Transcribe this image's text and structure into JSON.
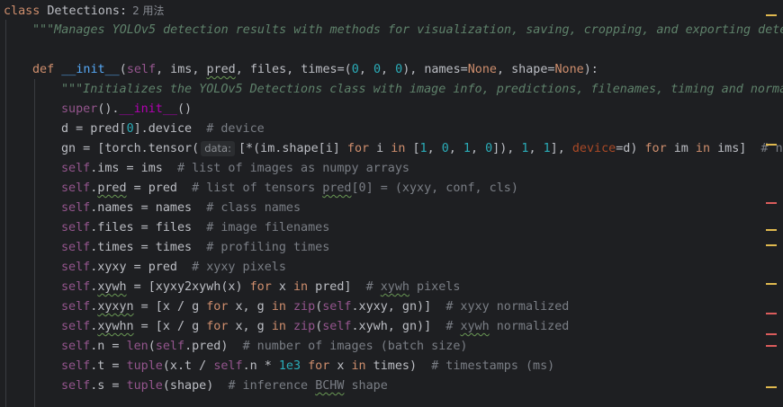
{
  "code": {
    "class_kw": "class",
    "class_name": "Detections",
    "class_colon": ":",
    "usages": "2 用法",
    "docstring_class": "\"\"\"Manages YOLOv5 detection results with methods for visualization, saving, cropping, and exporting dete",
    "def_kw": "def",
    "init_name": "__init__",
    "init_params_open": "(",
    "p_self": "self",
    "init_params_mid": ", ims, ",
    "p_pred": "pred",
    "init_params_mid2": ", files, times=(",
    "z1": "0",
    "c1": ", ",
    "z2": "0",
    "c2": ", ",
    "z3": "0",
    "init_params_mid3": "), names=",
    "none1": "None",
    "init_params_mid4": ", shape=",
    "none2": "None",
    "init_params_close": "):",
    "docstring_init": "\"\"\"Initializes the YOLOv5 Detections class with image info, predictions, filenames, timing and norma",
    "super_call": "super",
    "super_rest": "().",
    "super_init": "__init__",
    "super_end": "()",
    "d_line": "d = pred[",
    "d_zero": "0",
    "d_rest": "].device",
    "d_comment": "# device",
    "gn_start": "gn = [torch.tensor(",
    "gn_hint": "data:",
    "gn_mid": "[*(im.shape[i] ",
    "gn_for": "for",
    "gn_i": " i ",
    "gn_in": "in",
    "gn_list_open": " [",
    "gn_n1": "1",
    "gn_c1": ", ",
    "gn_n2": "0",
    "gn_c2": ", ",
    "gn_n3": "1",
    "gn_c3": ", ",
    "gn_n4": "0",
    "gn_close1": "]), ",
    "gn_n5": "1",
    "gn_c5": ", ",
    "gn_n6": "1",
    "gn_c6": "], ",
    "gn_device": "device",
    "gn_eq": "=d) ",
    "gn_for2": "for",
    "gn_im": " im ",
    "gn_in2": "in",
    "gn_ims": " ims]  ",
    "gn_comment": "# n",
    "l_ims_self": "self",
    "l_ims": ".ims = ims  ",
    "l_ims_c": "# list of images as numpy arrays",
    "l_pred_self": "self",
    "l_pred_dot": ".",
    "l_pred_name": "pred",
    "l_pred_eq": " = pred  ",
    "l_pred_c1": "# list of tensors ",
    "l_pred_c2": "pred",
    "l_pred_c3": "[0] = (xyxy, conf, cls)",
    "l_names_self": "self",
    "l_names": ".names = names  ",
    "l_names_c": "# class names",
    "l_files_self": "self",
    "l_files": ".files = files  ",
    "l_files_c": "# image filenames",
    "l_times_self": "self",
    "l_times": ".times = times  ",
    "l_times_c": "# profiling times",
    "l_xyxy_self": "self",
    "l_xyxy": ".xyxy = pred  ",
    "l_xyxy_c": "# xyxy pixels",
    "l_xywh_self": "self",
    "l_xywh_dot": ".",
    "l_xywh_name": "xywh",
    "l_xywh_eq": " = [xyxy2xywh(x) ",
    "l_xywh_for": "for",
    "l_xywh_x": " x ",
    "l_xywh_in": "in",
    "l_xywh_end": " pred]  ",
    "l_xywh_c1": "# ",
    "l_xywh_c2": "xywh",
    "l_xywh_c3": " pixels",
    "l_xyxyn_self": "self",
    "l_xyxyn_dot": ".",
    "l_xyxyn_name": "xyxyn",
    "l_xyxyn_eq": " = [x / g ",
    "l_xyxyn_for": "for",
    "l_xyxyn_xg": " x, g ",
    "l_xyxyn_in": "in",
    "l_xyxyn_sp": " ",
    "l_xyxyn_zip": "zip",
    "l_xyxyn_open": "(",
    "l_xyxyn_self2": "self",
    "l_xyxyn_end": ".xyxy, gn)]  ",
    "l_xyxyn_c": "# xyxy normalized",
    "l_xywhn_self": "self",
    "l_xywhn_dot": ".",
    "l_xywhn_name": "xywhn",
    "l_xywhn_eq": " = [x / g ",
    "l_xywhn_for": "for",
    "l_xywhn_xg": " x, g ",
    "l_xywhn_in": "in",
    "l_xywhn_sp": " ",
    "l_xywhn_zip": "zip",
    "l_xywhn_open": "(",
    "l_xywhn_self2": "self",
    "l_xywhn_end": ".xywh, gn)]  ",
    "l_xywhn_c1": "# ",
    "l_xywhn_c2": "xywh",
    "l_xywhn_c3": " normalized",
    "l_n_self": "self",
    "l_n_eq": ".n = ",
    "l_n_len": "len",
    "l_n_open": "(",
    "l_n_self2": "self",
    "l_n_end": ".pred)  ",
    "l_n_c": "# number of images (batch size)",
    "l_t_self": "self",
    "l_t_eq": ".t = ",
    "l_t_tuple": "tuple",
    "l_t_mid": "(x.t / ",
    "l_t_self2": "self",
    "l_t_mid2": ".n * ",
    "l_t_num": "1e3",
    "l_t_sp": " ",
    "l_t_for": "for",
    "l_t_x": " x ",
    "l_t_in": "in",
    "l_t_end": " times)  ",
    "l_t_c": "# timestamps (ms)",
    "l_s_self": "self",
    "l_s_eq": ".s = ",
    "l_s_tuple": "tuple",
    "l_s_end": "(shape)  ",
    "l_s_c1": "# inference ",
    "l_s_c2": "BCHW",
    "l_s_c3": " shape"
  },
  "colors": {
    "background": "#1e1f22",
    "keyword": "#cf8e6d",
    "function": "#56a8f5",
    "self": "#94558d",
    "number": "#2aacb8",
    "comment": "#7a7e85",
    "docstring": "#5f826b",
    "marker_warning": "#e0b94f",
    "marker_error": "#db5c5c"
  }
}
